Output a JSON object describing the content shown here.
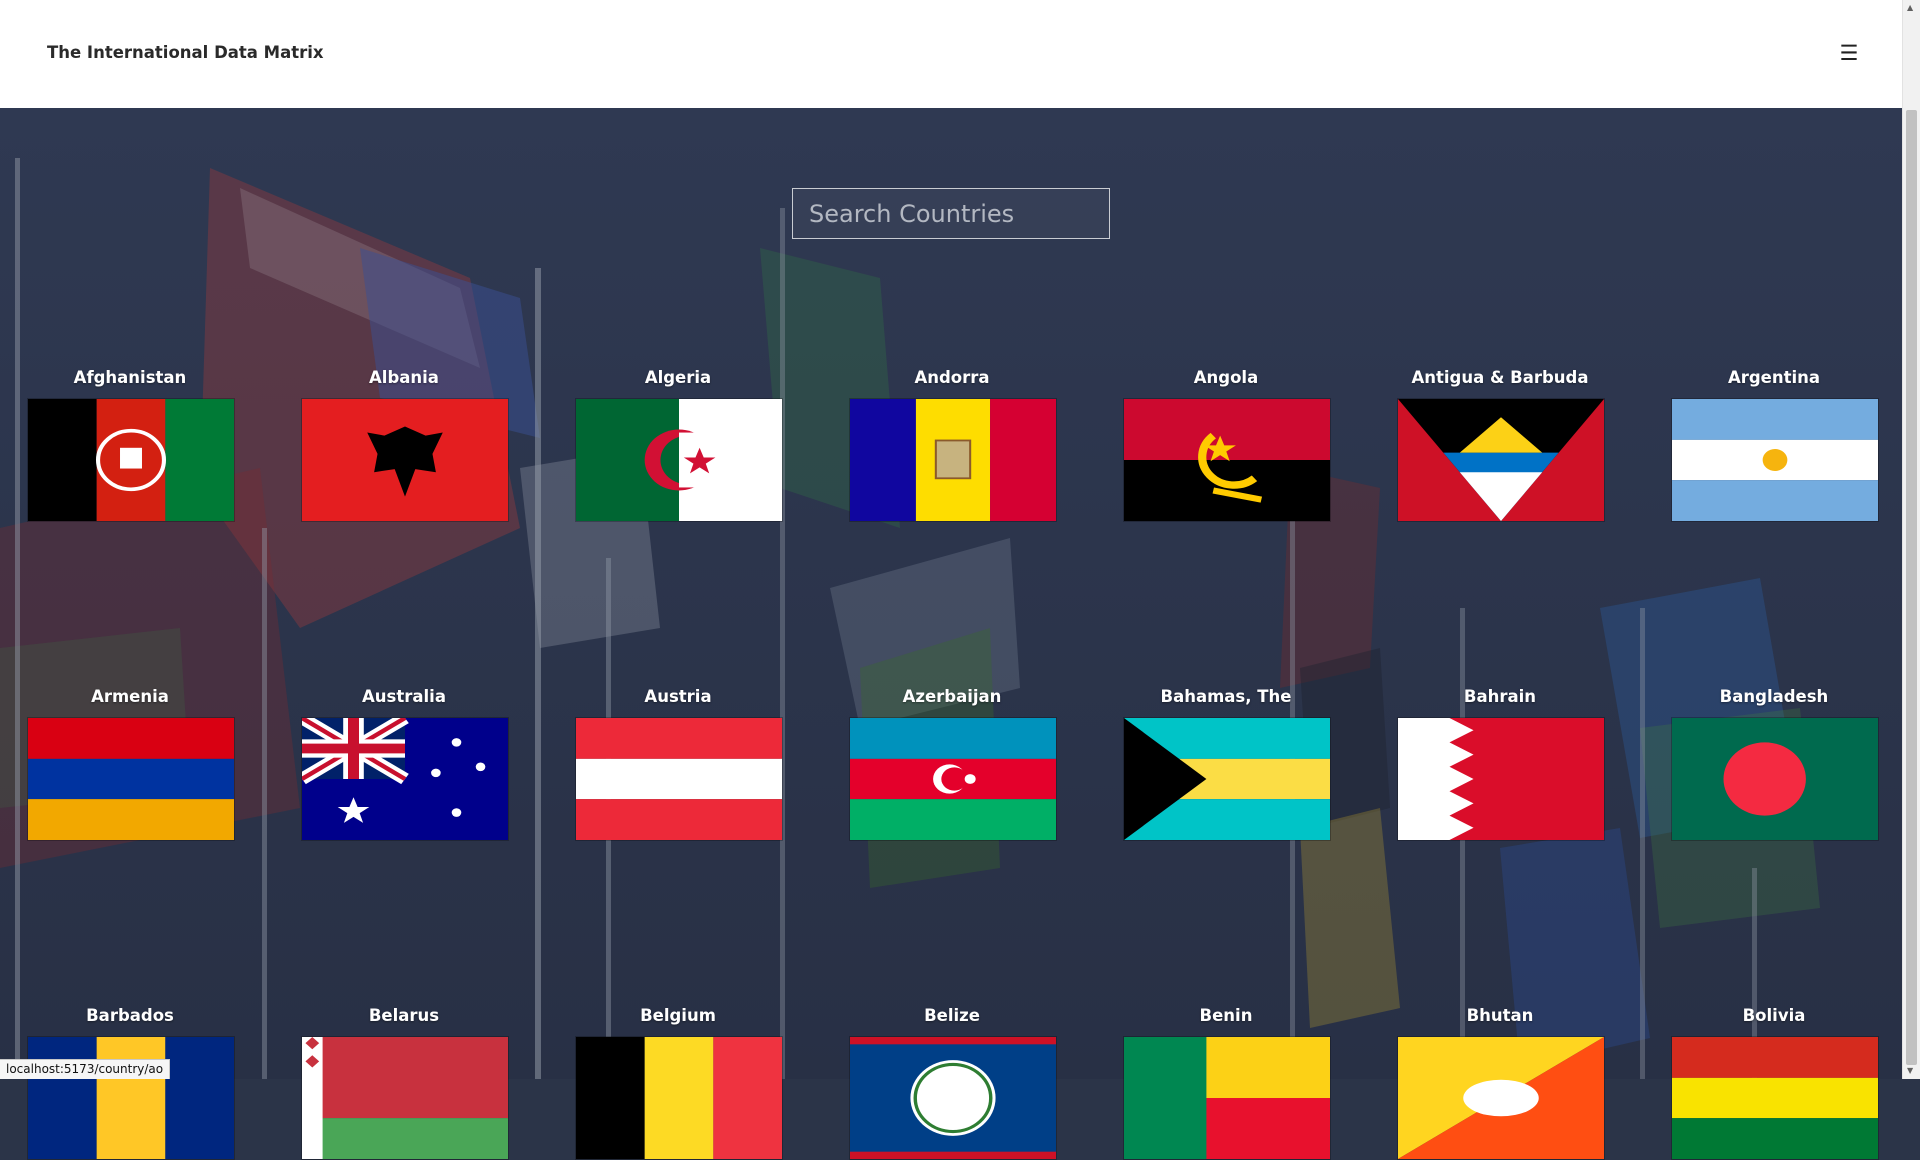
{
  "header": {
    "title": "The International Data Matrix",
    "menu_icon": "hamburger-icon"
  },
  "search": {
    "placeholder": "Search Countries",
    "value": ""
  },
  "countries": [
    "Afghanistan",
    "Albania",
    "Algeria",
    "Andorra",
    "Angola",
    "Antigua & Barbuda",
    "Argentina",
    "Armenia",
    "Australia",
    "Austria",
    "Azerbaijan",
    "Bahamas, The",
    "Bahrain",
    "Bangladesh",
    "Barbados",
    "Belarus",
    "Belgium",
    "Belize",
    "Benin",
    "Bhutan",
    "Bolivia"
  ],
  "status_bar": {
    "url": "localhost:5173/country/ao"
  }
}
